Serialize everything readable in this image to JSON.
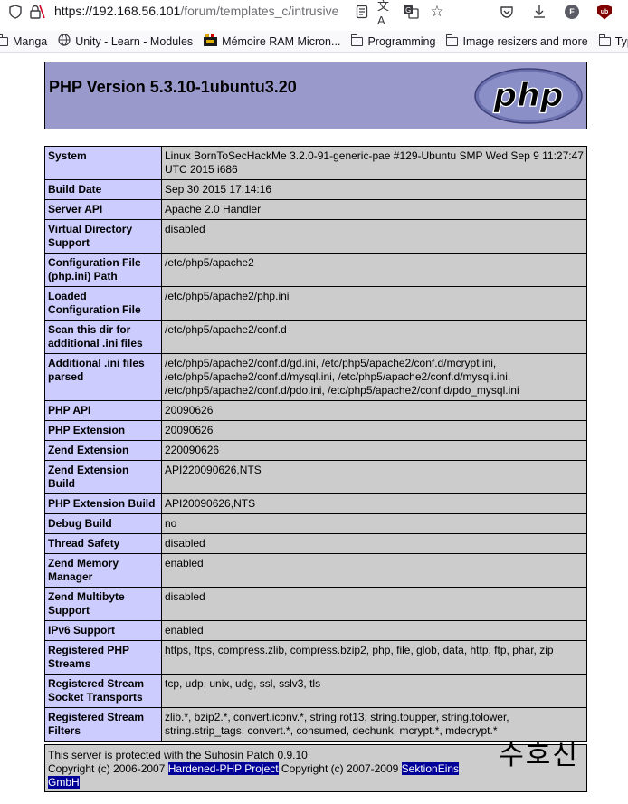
{
  "browser": {
    "url_host": "https://192.168.56.101",
    "url_path": "/forum/templates_c/intrusive",
    "bookmarks": [
      {
        "label": "Manga",
        "icon": "folder-icon"
      },
      {
        "label": "Unity - Learn - Modules",
        "icon": "globe-icon"
      },
      {
        "label": "Mémoire RAM Micron...",
        "icon": "ram-favicon-icon"
      },
      {
        "label": "Programming",
        "icon": "folder-icon"
      },
      {
        "label": "Image resizers and more",
        "icon": "folder-icon"
      },
      {
        "label": "Typin",
        "icon": "folder-icon"
      }
    ],
    "profile_initial": "F",
    "ublock_label": "ub"
  },
  "header": {
    "title": "PHP Version 5.3.10-1ubuntu3.20",
    "logo_text": "php"
  },
  "info_rows": [
    {
      "key": "System",
      "value": "Linux BornToSecHackMe 3.2.0-91-generic-pae #129-Ubuntu SMP Wed Sep 9 11:27:47 UTC 2015 i686"
    },
    {
      "key": "Build Date",
      "value": "Sep 30 2015 17:14:16"
    },
    {
      "key": "Server API",
      "value": "Apache 2.0 Handler"
    },
    {
      "key": "Virtual Directory Support",
      "value": "disabled"
    },
    {
      "key": "Configuration File (php.ini) Path",
      "value": "/etc/php5/apache2"
    },
    {
      "key": "Loaded Configuration File",
      "value": "/etc/php5/apache2/php.ini"
    },
    {
      "key": "Scan this dir for additional .ini files",
      "value": "/etc/php5/apache2/conf.d"
    },
    {
      "key": "Additional .ini files parsed",
      "value": "/etc/php5/apache2/conf.d/gd.ini, /etc/php5/apache2/conf.d/mcrypt.ini, /etc/php5/apache2/conf.d/mysql.ini, /etc/php5/apache2/conf.d/mysqli.ini, /etc/php5/apache2/conf.d/pdo.ini, /etc/php5/apache2/conf.d/pdo_mysql.ini"
    },
    {
      "key": "PHP API",
      "value": "20090626"
    },
    {
      "key": "PHP Extension",
      "value": "20090626"
    },
    {
      "key": "Zend Extension",
      "value": "220090626"
    },
    {
      "key": "Zend Extension Build",
      "value": "API220090626,NTS"
    },
    {
      "key": "PHP Extension Build",
      "value": "API20090626,NTS"
    },
    {
      "key": "Debug Build",
      "value": "no"
    },
    {
      "key": "Thread Safety",
      "value": "disabled"
    },
    {
      "key": "Zend Memory Manager",
      "value": "enabled"
    },
    {
      "key": "Zend Multibyte Support",
      "value": "disabled"
    },
    {
      "key": "IPv6 Support",
      "value": "enabled"
    },
    {
      "key": "Registered PHP Streams",
      "value": "https, ftps, compress.zlib, compress.bzip2, php, file, glob, data, http, ftp, phar, zip"
    },
    {
      "key": "Registered Stream Socket Transports",
      "value": "tcp, udp, unix, udg, ssl, sslv3, tls"
    },
    {
      "key": "Registered Stream Filters",
      "value": "zlib.*, bzip2.*, convert.iconv.*, string.rot13, string.toupper, string.tolower, string.strip_tags, convert.*, consumed, dechunk, mcrypt.*, mdecrypt.*"
    }
  ],
  "footer": {
    "line1": "This server is protected with the Suhosin Patch 0.9.10",
    "copyright1": "Copyright (c) 2006-2007 ",
    "link1": "Hardened-PHP Project",
    "copyright2": " Copyright (c) 2007-2009 ",
    "link2": "SektionEins GmbH",
    "korean_logo": "수호신"
  }
}
